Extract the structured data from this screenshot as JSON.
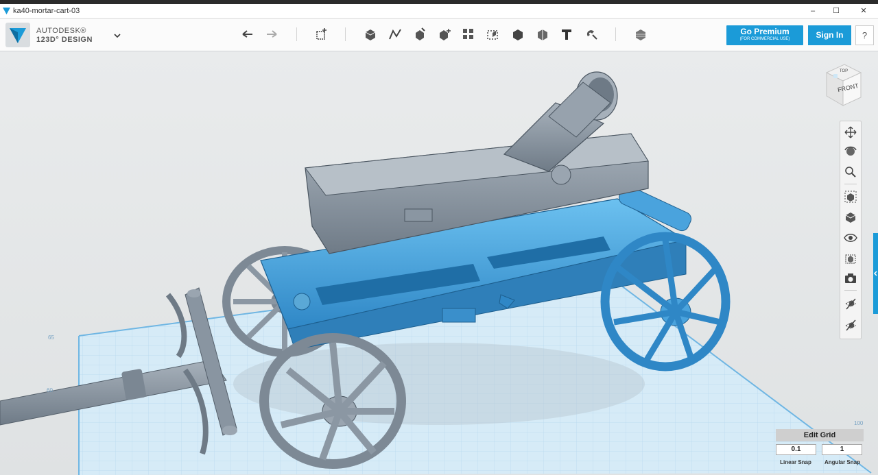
{
  "window": {
    "title": "ka40-mortar-cart-03",
    "controls": [
      "–",
      "☐",
      "✕"
    ]
  },
  "brand": {
    "line1": "AUTODESK®",
    "line2": "123D° DESIGN"
  },
  "toolbar": {
    "icons": [
      "undo-icon",
      "redo-icon",
      "transform-icon",
      "primitives-icon",
      "sketch-icon",
      "construct-icon",
      "modify-icon",
      "pattern-icon",
      "grouping-icon",
      "combine-icon",
      "measure-icon",
      "text-icon",
      "snap-icon",
      "material-icon"
    ]
  },
  "account": {
    "premium_label": "Go Premium",
    "premium_sub": "(FOR COMMERCIAL USE)",
    "signin_label": "Sign In",
    "help_label": "?"
  },
  "viewcube": {
    "top": "TOP",
    "front": "FRONT"
  },
  "navbar": {
    "icons": [
      "pan-icon",
      "orbit-icon",
      "zoom-icon",
      "fit-icon",
      "view-icon",
      "visibility-icon",
      "materials-view-icon",
      "camera-icon",
      "hide-grid-icon",
      "snap-view-icon"
    ]
  },
  "grid": {
    "edit_label": "Edit Grid",
    "linear_snap_value": "0.1",
    "linear_snap_label": "Linear Snap",
    "angular_snap_value": "1",
    "angular_snap_label": "Angular Snap"
  },
  "axis_labels": {
    "a": "65",
    "b": "60",
    "c": "100"
  },
  "colors": {
    "accent": "#1b9bd8",
    "selected_part": "#4aa3dd",
    "model_gray": "#8f9aa5"
  }
}
